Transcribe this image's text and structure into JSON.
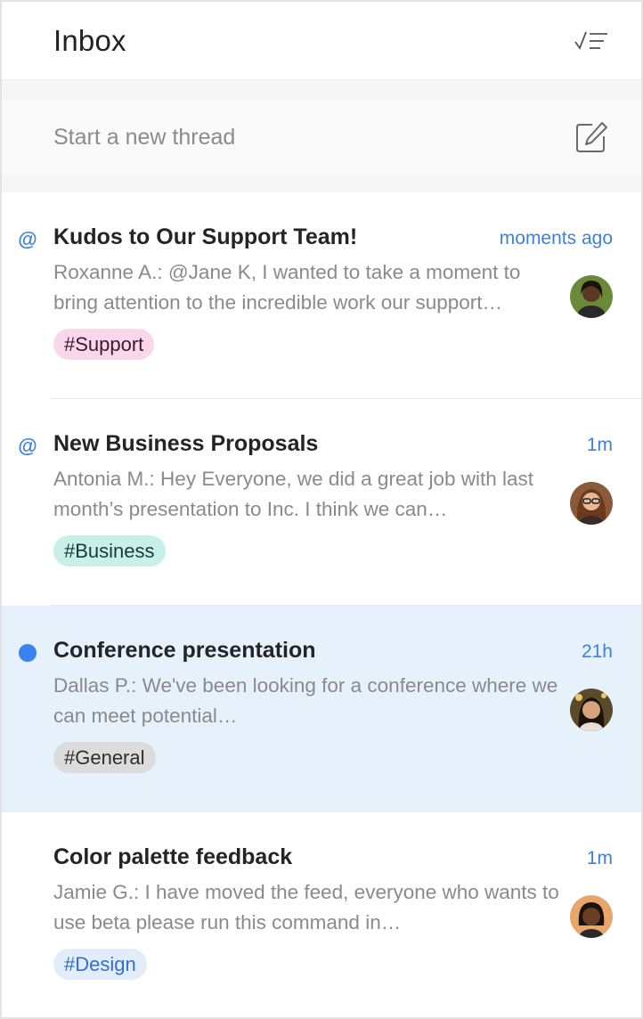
{
  "header": {
    "title": "Inbox",
    "mark_read_icon": "checklist-icon"
  },
  "new_thread": {
    "placeholder": "Start a new thread",
    "compose_icon": "compose-icon"
  },
  "colors": {
    "accent": "#3b82e0",
    "selected_bg": "#e6f1fc"
  },
  "threads": [
    {
      "indicator": "mention",
      "indicator_symbol": "@",
      "title": "Kudos to Our Support Team!",
      "time": "moments ago",
      "preview": "Roxanne A.: @Jane K, I wanted to take a moment to bring attention to the incredible work our support…",
      "tag": "#Support",
      "tag_bg": "#fbd7eb",
      "tag_color": "#3a1a2c",
      "selected": false
    },
    {
      "indicator": "mention",
      "indicator_symbol": "@",
      "title": "New Business Proposals",
      "time": "1m",
      "preview": "Antonia M.: Hey Everyone, we did a great job with last month’s presentation to Inc. I think we can…",
      "tag": "#Business",
      "tag_bg": "#c9efe9",
      "tag_color": "#173b36",
      "selected": false
    },
    {
      "indicator": "unread",
      "title": "Conference presentation",
      "time": "21h",
      "preview": "Dallas P.: We've been looking for a conference where we can meet potential…",
      "tag": "#General",
      "tag_bg": "#dcdcdc",
      "tag_color": "#2f2f2f",
      "selected": true
    },
    {
      "indicator": "none",
      "title": "Color palette feedback",
      "time": "1m",
      "preview": "Jamie G.: I have moved the feed, everyone who wants to use beta please run this command in…",
      "tag": "#Design",
      "tag_bg": "#e2edfb",
      "tag_color": "#2f6fd0",
      "selected": false
    }
  ]
}
